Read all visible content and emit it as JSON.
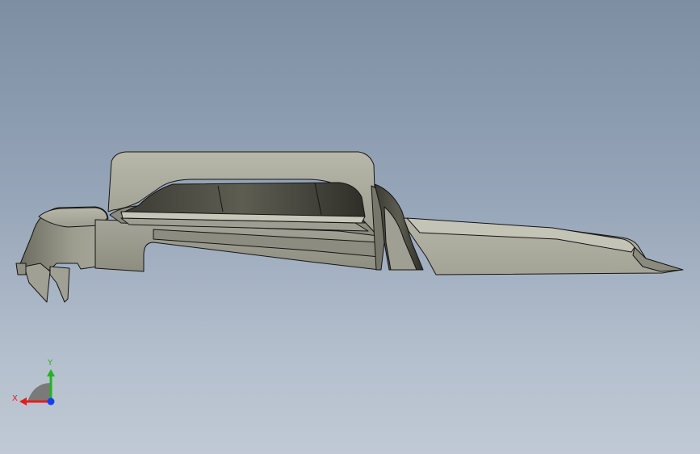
{
  "viewport": {
    "background_top": "#7d8ea3",
    "background_bottom": "#c0c9d5"
  },
  "model": {
    "part_color": "#a9a99c",
    "edge_color": "#141414"
  },
  "triad": {
    "x_label": "X",
    "y_label": "Y",
    "x_color": "#e41d1d",
    "y_color": "#1fb51f",
    "z_color": "#1a3fe8"
  }
}
